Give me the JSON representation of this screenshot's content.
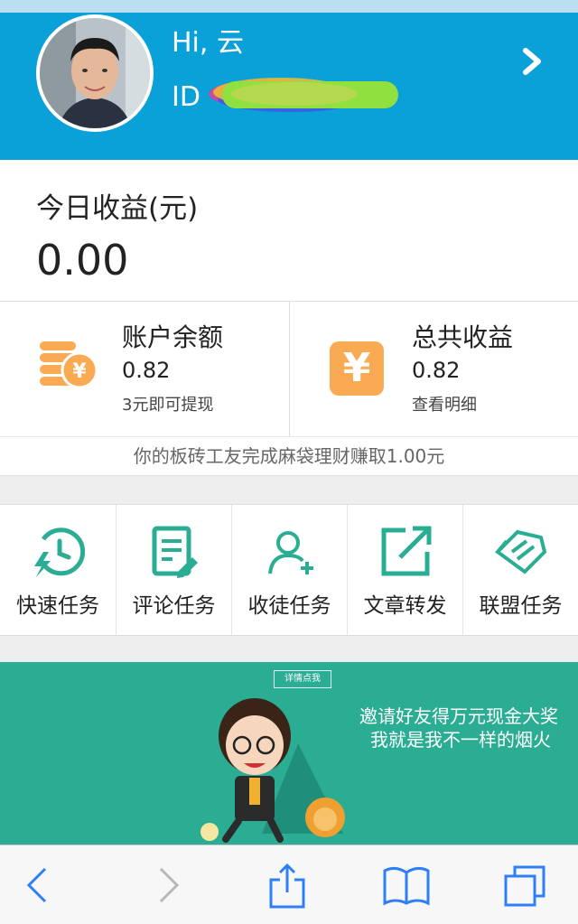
{
  "header": {
    "greeting": "Hi, 云",
    "id_label": "ID"
  },
  "today": {
    "label": "今日收益(元)",
    "value": "0.00"
  },
  "stats": [
    {
      "title": "账户余额",
      "value": "0.82",
      "sub": "3元即可提现",
      "icon": "coins-icon"
    },
    {
      "title": "总共收益",
      "value": "0.82",
      "sub": "查看明细",
      "icon": "yen-icon"
    }
  ],
  "notice": "你的板砖工友完成麻袋理财赚取1.00元",
  "tasks": [
    {
      "label": "快速任务",
      "icon": "fast-task-icon"
    },
    {
      "label": "评论任务",
      "icon": "comment-task-icon"
    },
    {
      "label": "收徒任务",
      "icon": "add-apprentice-icon"
    },
    {
      "label": "文章转发",
      "icon": "share-article-icon"
    },
    {
      "label": "联盟任务",
      "icon": "alliance-task-icon"
    }
  ],
  "banner": {
    "button": "详情点我",
    "line1": "邀请好友得万元现金大奖",
    "line2": "我就是我不一样的烟火"
  },
  "colors": {
    "primary": "#0aa0d8",
    "teal": "#2bad94",
    "orange": "#f9aa52"
  },
  "toolbar": {
    "icons": [
      "back-icon",
      "forward-icon",
      "share-icon",
      "bookmarks-icon",
      "tabs-icon"
    ]
  }
}
